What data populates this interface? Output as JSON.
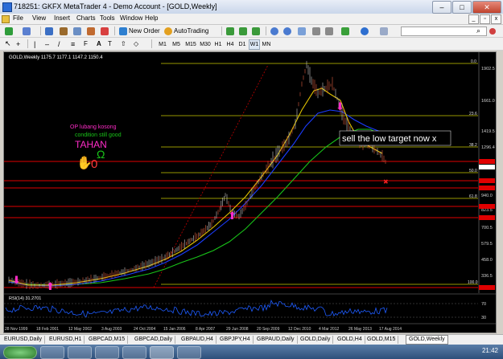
{
  "window": {
    "title": "718251: GKFX MetaTrader 4 - Demo Account - [GOLD,Weekly]"
  },
  "menu": [
    "File",
    "View",
    "Insert",
    "Charts",
    "Tools",
    "Window",
    "Help"
  ],
  "toolbar": {
    "new_order": "New Order",
    "autotrading": "AutoTrading",
    "timeframes": [
      "M1",
      "M5",
      "M15",
      "M30",
      "H1",
      "H4",
      "D1",
      "W1",
      "MN"
    ],
    "active_timeframe": "W1"
  },
  "chart": {
    "header": "GOLD,Weekly  1175.7 1177.1 1147.2 1150.4",
    "price_labels": [
      "1902.5",
      "1661.0",
      "1419.5",
      "1296.4",
      "940.0",
      "823.5",
      "700.5",
      "579.5",
      "458.0",
      "336.5"
    ],
    "fib_labels": [
      "0.0",
      "23.6",
      "38.2",
      "50.0",
      "61.8",
      "100.0"
    ],
    "rsi_label": "RSI(14) 31.2701",
    "rsi_levels": [
      "70",
      "30"
    ],
    "date_labels": [
      "28 Nov 1999",
      "18 Feb 2001",
      "12 May 2002",
      "3 Aug 2003",
      "24 Oct 2004",
      "15 Jan 2006",
      "8 Apr 2007",
      "29 Jun 2008",
      "20 Sep 2009",
      "12 Dec 2010",
      "4 Mar 2012",
      "26 May 2013",
      "17 Aug 2014"
    ],
    "annotation_text": "sell the low target now x",
    "note_line1": "OP lubang kosong",
    "note_line2": "condition still good",
    "note_line3": "TAHAN",
    "colors": {
      "background": "#000000",
      "candles": "#c8c8c8",
      "ma_fast": "#e0c200",
      "ma_mid": "#1b3cff",
      "ma_slow": "#19c419",
      "fib": "#c8c800",
      "red_line": "#e00000",
      "rsi": "#1e5cff"
    }
  },
  "tabs": [
    "EURUSD,Daily",
    "EURUSD,H1",
    "GBPCAD,M15",
    "GBPCAD,Daily",
    "GBPAUD,H4",
    "GBPJPY,H4",
    "GBPAUD,Daily",
    "GOLD,Daily",
    "GOLD,H4",
    "GOLD,M15",
    "GOLD,Weekly"
  ],
  "active_tab": "GOLD,Weekly",
  "clock": "21:42"
}
